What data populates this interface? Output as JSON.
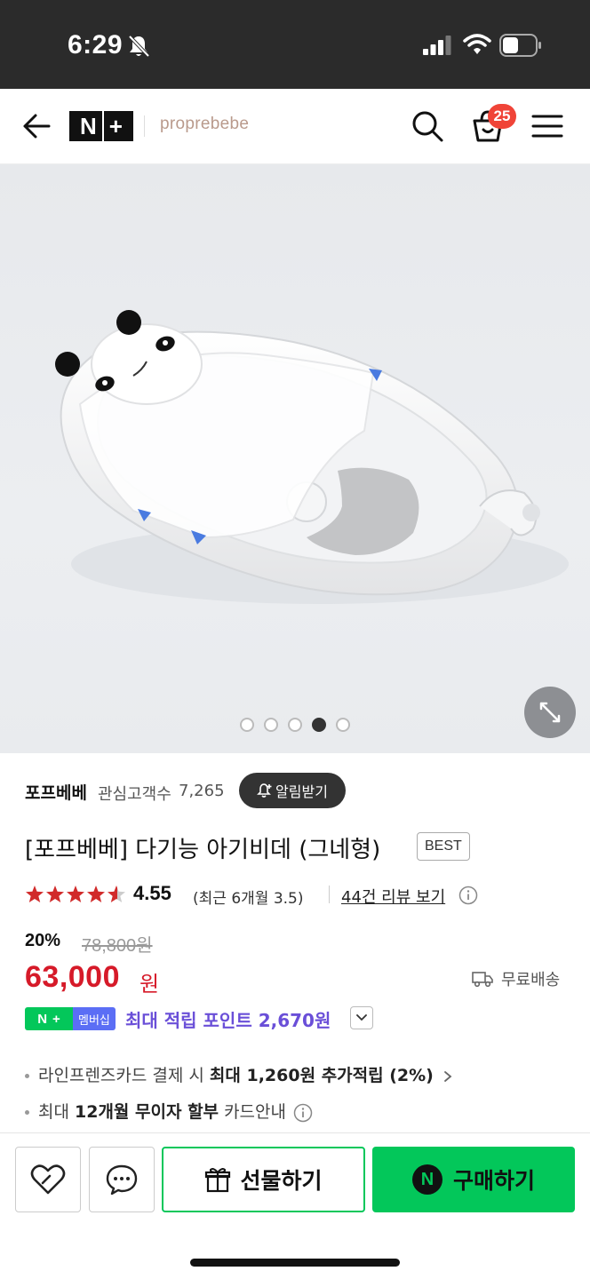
{
  "status_bar": {
    "time": "6:29",
    "icons": [
      "bell-off-icon",
      "signal-icon",
      "wifi-icon",
      "battery-icon"
    ]
  },
  "header": {
    "logo_text": "N+",
    "brand_logo": "proprebebe",
    "cart_count": "25",
    "icons": [
      "back-arrow-icon",
      "search-icon",
      "cart-icon",
      "menu-icon"
    ]
  },
  "product_image": {
    "alt": "",
    "carousel_total": 5,
    "carousel_active": 4
  },
  "store": {
    "name": "포프베베",
    "followers_label": "관심고객수",
    "followers_count": "7,265",
    "alarm_label": "알림받기"
  },
  "product": {
    "title": "[포프베베] 다기능 아기비데 (그네형)",
    "badge": "BEST"
  },
  "rating": {
    "stars": 4.55,
    "value": "4.55",
    "recent": "(최근 6개월 3.5)",
    "review_link": "44건 리뷰 보기"
  },
  "price": {
    "discount": "20%",
    "original": "78,800원",
    "sale": "63,000",
    "unit": "원",
    "shipping": "무료배송"
  },
  "membership": {
    "badge_np": "N",
    "badge_label": "멤버십",
    "points_text": "최대 적립 포인트 2,670원"
  },
  "benefits": [
    {
      "pre": "라인프렌즈카드 결제 시 ",
      "bold": "최대 1,260원 추가적립 (2%)",
      "post": ""
    },
    {
      "pre": "최대 ",
      "bold": "12개월 무이자 할부",
      "post": " 카드안내"
    }
  ],
  "bottom_bar": {
    "gift_label": "선물하기",
    "buy_label": "구매하기",
    "npay_letter": "N"
  },
  "colors": {
    "accent_green": "#03c75a",
    "price_red": "#d61a29",
    "points_purple": "#6a4fd8",
    "badge_red": "#f04438"
  }
}
